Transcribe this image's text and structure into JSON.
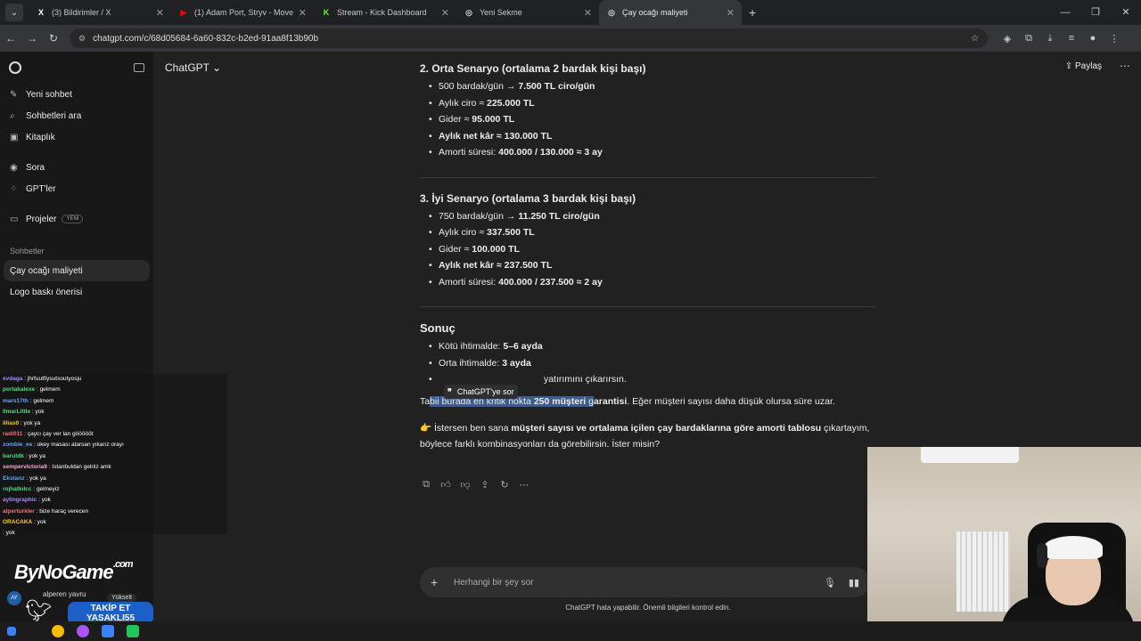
{
  "browser": {
    "tabs": [
      {
        "title": "(3) Bildirimler / X",
        "icon": "X",
        "color": "#ffffff"
      },
      {
        "title": "(1) Adam Port, Stryv - Move",
        "icon": "▶",
        "color": "#ff0000"
      },
      {
        "title": "Stream - Kick Dashboard",
        "icon": "K",
        "color": "#53fc18"
      },
      {
        "title": "Yeni Sekme",
        "icon": "◎",
        "color": "#cccccc"
      },
      {
        "title": "Çay ocağı maliyeti",
        "icon": "◎",
        "color": "#cccccc"
      }
    ],
    "url": "chatgpt.com/c/68d05684-6a60-832c-b2ed-91aa8f13b90b"
  },
  "sidebar": {
    "items": [
      {
        "label": "Yeni sohbet",
        "icon": "✎"
      },
      {
        "label": "Sohbetleri ara",
        "icon": "⌕"
      },
      {
        "label": "Kitaplık",
        "icon": "▣"
      }
    ],
    "items2": [
      {
        "label": "Sora",
        "icon": "◉"
      },
      {
        "label": "GPT'ler",
        "icon": "⁘"
      }
    ],
    "projects_label": "Projeler",
    "projects_badge": "YENİ",
    "section_title": "Sohbetler",
    "chats": [
      "Çay ocağı maliyeti",
      "Logo baskı önerisi"
    ]
  },
  "header": {
    "model": "ChatGPT",
    "share": "Paylaş"
  },
  "content": {
    "s2_title": "2. Orta Senaryo (ortalama 2 bardak kişi başı)",
    "s2": [
      {
        "pre": "500 bardak/gün → ",
        "bold": "7.500 TL ciro/gün",
        "post": ""
      },
      {
        "pre": "Aylık ciro ≈ ",
        "bold": "225.000 TL",
        "post": ""
      },
      {
        "pre": "Gider ≈ ",
        "bold": "95.000 TL",
        "post": ""
      },
      {
        "pre": "",
        "bold": "Aylık net kâr ≈ 130.000 TL",
        "post": ""
      },
      {
        "pre": "Amorti süresi: ",
        "bold": "400.000 / 130.000 ≈ 3 ay",
        "post": ""
      }
    ],
    "s3_title": "3. İyi Senaryo (ortalama 3 bardak kişi başı)",
    "s3": [
      {
        "pre": "750 bardak/gün → ",
        "bold": "11.250 TL ciro/gün",
        "post": ""
      },
      {
        "pre": "Aylık ciro ≈ ",
        "bold": "337.500 TL",
        "post": ""
      },
      {
        "pre": "Gider ≈ ",
        "bold": "100.000 TL",
        "post": ""
      },
      {
        "pre": "",
        "bold": "Aylık net kâr ≈ 237.500 TL",
        "post": ""
      },
      {
        "pre": "Amorti süresi: ",
        "bold": "400.000 / 237.500 ≈ 2 ay",
        "post": ""
      }
    ],
    "result_title": "Sonuç",
    "result": [
      {
        "pre": "Kötü ihtimalde: ",
        "bold": "5–6 ayda",
        "post": ""
      },
      {
        "pre": "Orta ihtimalde: ",
        "bold": "3 ayda",
        "post": ""
      },
      {
        "pre": "",
        "bold": "",
        "post": "yatırımını çıkarırsın."
      }
    ],
    "tooltip": "ChatGPT'ye sor",
    "p1_a": "Ta",
    "p1_hl": "bii burada en kritik nokta ",
    "p1_hlb": "250 müşteri",
    "p1_hl2": " g",
    "p1_b": "arantisi",
    "p1_c": ". Eğer müşteri sayısı daha düşük olursa süre uzar.",
    "p2_icon": "👉",
    "p2_a": " İstersen ben sana ",
    "p2_b": "müşteri sayısı ve ortalama içilen çay bardaklarına göre amorti tablosu",
    "p2_c": " çıkartayım, böylece farklı kombinasyonları da görebilirsin. İster misin?"
  },
  "composer": {
    "placeholder": "Herhangi bir şey sor",
    "disclaimer": "ChatGPT hata yapabilir. Önemli bilgileri kontrol edin."
  },
  "stream_chat": [
    {
      "user": "evdaga",
      "msg": "jhrfuutfiysutsoutyosju",
      "color": "#a78bfa"
    },
    {
      "user": "portakalexe",
      "msg": "gelmem",
      "color": "#4ade80"
    },
    {
      "user": "mars17th",
      "msg": "gelmem",
      "color": "#60a5fa"
    },
    {
      "user": "0marLittle",
      "msg": "yok",
      "color": "#4ade80"
    },
    {
      "user": "illias0",
      "msg": "yok ya",
      "color": "#facc15"
    },
    {
      "user": "radi011",
      "msg": "çaycı çay ver lan göööööt",
      "color": "#f87171"
    },
    {
      "user": "zombie_ee",
      "msg": "okey masası atarsan yıkarız orayı",
      "color": "#60a5fa"
    },
    {
      "user": "barutdk",
      "msg": "yok ya",
      "color": "#4ade80"
    },
    {
      "user": "sempervictoria9",
      "msg": "Istanbuldan gelriiz amk",
      "color": "#f9a8d4"
    },
    {
      "user": "Ekstanz",
      "msg": "yok ya",
      "color": "#60a5fa"
    },
    {
      "user": "rojhatkılcc",
      "msg": "gelmeyiz",
      "color": "#4ade80"
    },
    {
      "user": "aylingraphic",
      "msg": "yok",
      "color": "#a78bfa"
    },
    {
      "user": "alperturkler",
      "msg": "bize haraç verecen",
      "color": "#f87171"
    },
    {
      "user": "ORACAKA",
      "msg": "yok",
      "color": "#facc15"
    },
    {
      "user": "",
      "msg": "yok",
      "color": "#ffffff"
    }
  ],
  "overlay": {
    "brand": "ByNoGame",
    "brand_suffix": ".com",
    "user_initials": "AY",
    "user_name": "alperen yavru",
    "upgrade": "Yükselt",
    "follow_1": "TAKİP ET",
    "follow_2": "YASAKLI55"
  }
}
